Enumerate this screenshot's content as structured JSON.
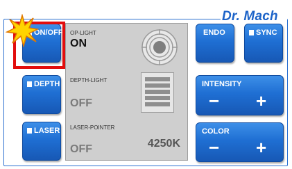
{
  "brand": "Dr. Mach",
  "left_buttons": [
    {
      "label": "ON/OFF"
    },
    {
      "label": "DEPTH"
    },
    {
      "label": "LASER"
    }
  ],
  "panel": {
    "op_light": {
      "label": "OP-LIGHT",
      "value": "ON"
    },
    "depth_light": {
      "label": "DEPTH-LIGHT",
      "value": "OFF"
    },
    "laser_pointer": {
      "label": "LASER-POINTER",
      "value": "OFF"
    },
    "color_temp": "4250K"
  },
  "right_buttons": {
    "endo": "ENDO",
    "sync": "SYNC",
    "intensity": {
      "label": "INTENSITY",
      "minus": "−",
      "plus": "+"
    },
    "color": {
      "label": "COLOR",
      "minus": "−",
      "plus": "+"
    }
  },
  "colors": {
    "accent": "#1f6fd3",
    "highlight": "#e20d0d",
    "brand": "#1c63c8"
  }
}
